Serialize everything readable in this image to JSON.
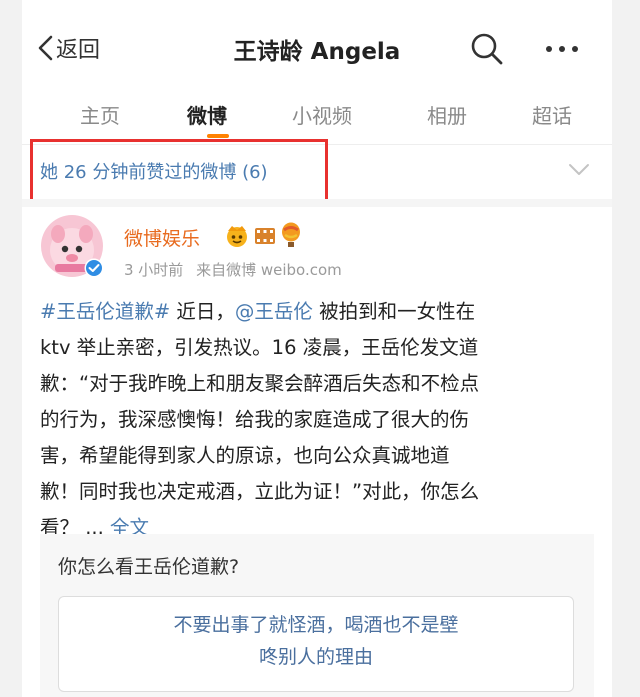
{
  "nav": {
    "back_label": "返回",
    "title": "王诗龄 Angela"
  },
  "tabs": [
    {
      "label": "主页",
      "active": false
    },
    {
      "label": "微博",
      "active": true
    },
    {
      "label": "小视频",
      "active": false
    },
    {
      "label": "相册",
      "active": false
    },
    {
      "label": "超话",
      "active": false
    }
  ],
  "liked": {
    "text": "她 26 分钟前赞过的微博 (6)"
  },
  "post": {
    "author": "微博娱乐",
    "badges": [
      "crown-emoji-icon",
      "film-emoji-icon",
      "balloon-emoji-icon"
    ],
    "time": "3 小时前",
    "source": "来自微博 weibo.com",
    "hashtag": "#王岳伦道歉#",
    "text_1": " 近日，",
    "mention": "@王岳伦",
    "text_2": " 被拍到和一女性在\nktv 举止亲密，引发热议。16 凌晨，王岳伦发文道\n歉：“对于我昨晚上和朋友聚会醉酒后失态和不检点\n的行为，我深感懊悔！给我的家庭造成了很大的伤\n害，希望能得到家人的原谅，也向公众真诚地道\n歉！同时我也决定戒酒，立此为证！”对此，你怎么\n看？  ... ",
    "full_text_link": "全文"
  },
  "poll": {
    "question": "你怎么看王岳伦道歉?",
    "option_1": "不要出事了就怪酒，喝酒也不是壁\n咚别人的理由"
  },
  "colors": {
    "accent_orange": "#ff8200",
    "link_blue": "#4a7bb0",
    "highlight_red": "#e8312f",
    "author_orange": "#e86b1f"
  }
}
